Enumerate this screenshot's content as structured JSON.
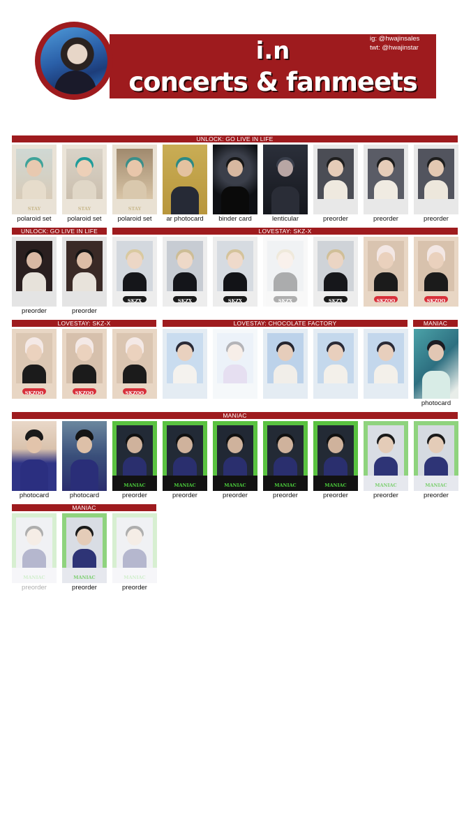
{
  "header": {
    "title_line1": "i.n",
    "title_line2": "concerts & fanmeets",
    "ig": "ig: @hwajinsales",
    "twt": "twt: @hwajinstar"
  },
  "sections": {
    "s1": "UNLOCK: GO LIVE IN LIFE",
    "s2": "UNLOCK: GO LIVE IN LIFE",
    "s3": "LOVESTAY: SKZ-X",
    "s4": "LOVESTAY: SKZ-X",
    "s5": "LOVESTAY: CHOCOLATE FACTORY",
    "s6": "MANIAC",
    "s7": "MANIAC",
    "s8": "MANIAC"
  },
  "labels": {
    "polaroid": "polaroid set",
    "ar": "ar photocard",
    "binder": "binder card",
    "lenticular": "lenticular",
    "preorder": "preorder",
    "photocard": "photocard"
  },
  "card_text": {
    "stay": "STAY",
    "skzx": "SKZX",
    "skzoo": "SKZOO",
    "maniac": "MANIAC"
  }
}
